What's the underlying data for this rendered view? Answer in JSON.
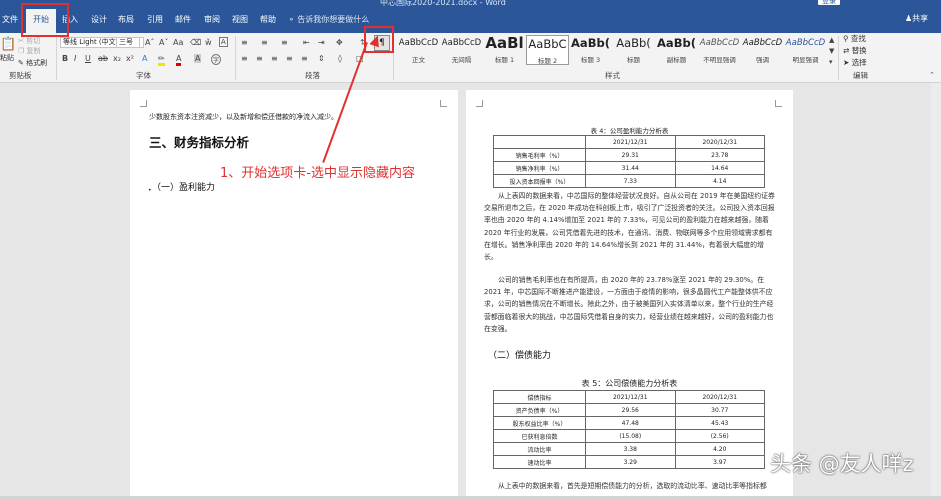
{
  "window": {
    "title": "中芯国际2020-2021.docx - Word",
    "login_label": "登录"
  },
  "tabs": [
    "文件",
    "开始",
    "插入",
    "设计",
    "布局",
    "引用",
    "邮件",
    "审阅",
    "视图",
    "帮助"
  ],
  "tell_me": "告诉我你想要做什么",
  "share": "共享",
  "ribbon": {
    "clipboard": {
      "paste": "粘贴",
      "cut": "剪切",
      "copy": "复制",
      "format_painter": "格式刷",
      "label": "剪贴板"
    },
    "font": {
      "name": "等线 Light (中文",
      "size": "三号",
      "label": "字体"
    },
    "paragraph": {
      "label": "段落"
    },
    "styles": {
      "label": "样式",
      "items": [
        {
          "preview": "AaBbCcD",
          "name": "正文"
        },
        {
          "preview": "AaBbCcD",
          "name": "无间隔"
        },
        {
          "preview": "AaBl",
          "name": "标题 1"
        },
        {
          "preview": "AaBbC",
          "name": "标题 2"
        },
        {
          "preview": "AaBb(",
          "name": "标题 3"
        },
        {
          "preview": "AaBb(",
          "name": "标题"
        },
        {
          "preview": "AaBb(",
          "name": "副标题"
        },
        {
          "preview": "AaBbCcD",
          "name": "不明显强调"
        },
        {
          "preview": "AaBbCcD",
          "name": "强调"
        },
        {
          "preview": "AaBbCcD",
          "name": "明显强调"
        }
      ]
    },
    "editing": {
      "find": "查找",
      "replace": "替换",
      "select": "选择",
      "label": "编辑"
    }
  },
  "annotation": "1、开始选项卡-选中显示隐藏内容",
  "left_page": {
    "line1": "少数股东资本注资减少，以及新增和偿还借款的净流入减少。",
    "heading": "三、财务指标分析",
    "subheading": "（一）盈利能力"
  },
  "right_page": {
    "table4": {
      "caption": "表 4：公司盈利能力分析表",
      "header": [
        "",
        "2021/12/31",
        "2020/12/31"
      ],
      "rows": [
        [
          "销售毛利率（%）",
          "29.31",
          "23.78"
        ],
        [
          "销售净利率（%）",
          "31.44",
          "14.64"
        ],
        [
          "投入资本回报率（%）",
          "7.33",
          "4.14"
        ]
      ]
    },
    "para1": "从上表四的数据来看，中芯国际的整体经营状况良好。自从公司在 2019 年在美国纽约证券交易所退市之后，在 2020 年成功在科创板上市，吸引了广泛投资者的关注。公司投入资本回报率也由 2020 年的 4.14%增加至 2021 年的 7.33%，可见公司的盈利能力在越来越强，随着 2020 年行业的发展，公司凭借着先进的技术，在通讯、消费、物联网等多个应用领域需求都有在增长。销售净利率由 2020 年的 14.64%增长到 2021 年的 31.44%，有着很大幅度的增长。",
    "para2": "公司的销售毛利率也在有所提高，由 2020 年的 23.78%涨至 2021 年的 29.30%。在 2021 年，中芯国际不断推进产能建设，一方面由于疫情的影响，很多晶圆代工产能整体供不应求，公司的销售情况在不断增长。除此之外，由于被美国列入实体清单以来，整个行业的生产经营都面临着很大的挑战，中芯国际凭借着自身的实力，经营业绩在越来越好，公司的盈利能力也在变强。",
    "heading2": "（二）偿债能力",
    "table5": {
      "caption": "表 5：公司偿债能力分析表",
      "header": [
        "偿债指标",
        "2021/12/31",
        "2020/12/31"
      ],
      "rows": [
        [
          "资产负债率（%）",
          "29.56",
          "30.77"
        ],
        [
          "股东权益比率（%）",
          "47.48",
          "45.43"
        ],
        [
          "已获利息倍数",
          "(15.08)",
          "(2.56)"
        ],
        [
          "流动比率",
          "3.38",
          "4.20"
        ],
        [
          "速动比率",
          "3.29",
          "3.97"
        ]
      ]
    },
    "para3": "从上表中的数据来看，首先是短期偿债能力的分析，选取的流动比率、速动比率等指标都"
  },
  "watermark": "头条 @友人咩z"
}
